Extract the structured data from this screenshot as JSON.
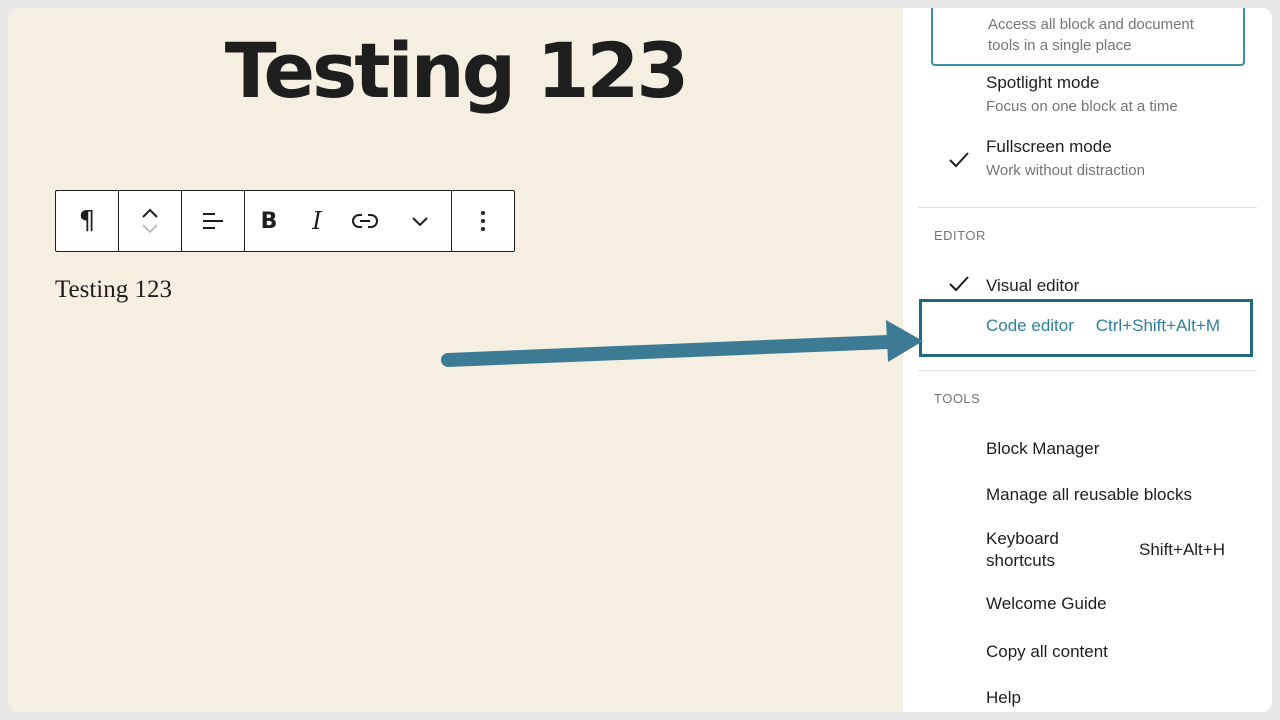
{
  "post": {
    "title": "Testing 123",
    "paragraph": "Testing 123"
  },
  "toolbar": {
    "paragraph_icon": "¶",
    "bold": "B",
    "italic": "I",
    "icons": [
      "pilcrow-icon",
      "move-up-down-icon",
      "align-left-icon",
      "bold-icon",
      "italic-icon",
      "link-icon",
      "chevron-down-icon",
      "more-vertical-icon"
    ]
  },
  "menu": {
    "top_item_desc_1": "Access all block and document",
    "top_item_desc_2": "tools in a single place",
    "spotlight": {
      "label": "Spotlight mode",
      "desc": "Focus on one block at a time"
    },
    "fullscreen": {
      "label": "Fullscreen mode",
      "desc": "Work without distraction",
      "checked": true
    },
    "editor_section": "EDITOR",
    "visual_editor": {
      "label": "Visual editor",
      "checked": true
    },
    "code_editor": {
      "label": "Code editor",
      "shortcut": "Ctrl+Shift+Alt+M"
    },
    "tools_section": "TOOLS",
    "block_manager": "Block Manager",
    "manage_reusable": "Manage all reusable blocks",
    "keyboard_shortcuts": {
      "label_1": "Keyboard",
      "label_2": "shortcuts",
      "shortcut": "Shift+Alt+H"
    },
    "welcome_guide": "Welcome Guide",
    "copy_all": "Copy all content",
    "help": "Help"
  },
  "colors": {
    "editor_bg": "#f4efe1",
    "highlight_border": "#1f6a7e",
    "accent_text": "#2f7fa0",
    "arrow": "#3d7a94"
  }
}
